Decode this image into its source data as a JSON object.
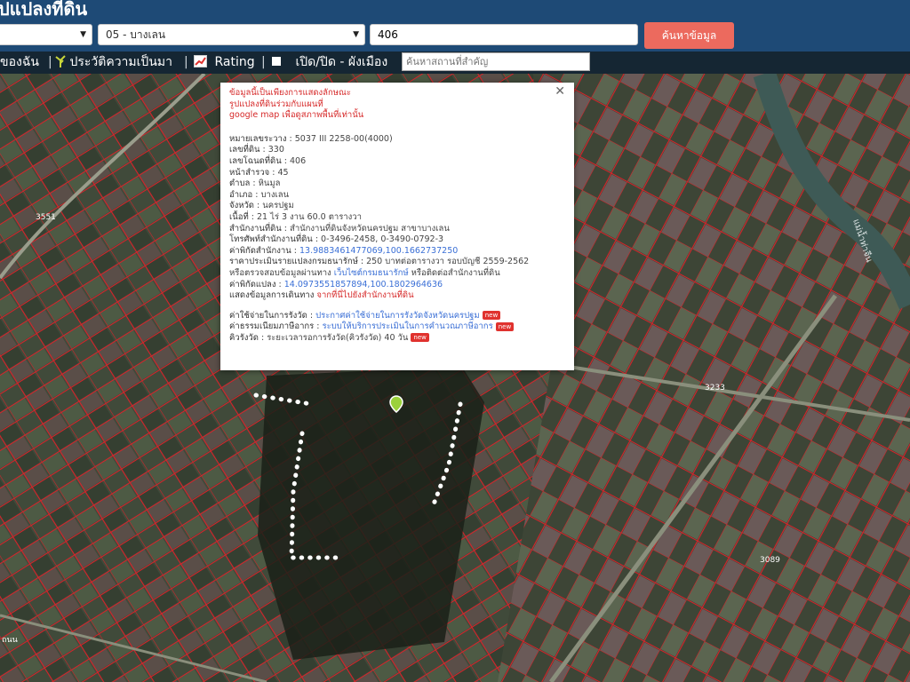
{
  "header": {
    "title": "ปแปลงที่ดิน",
    "province_select": "",
    "district_select": "05 - บางเลน",
    "parcel_value": "406",
    "search_label": "ค้นหาข้อมูล"
  },
  "toolbar": {
    "item1": "ของฉัน",
    "sep": "|",
    "item2": "ประวัติความเป็นมา",
    "item3": "Rating",
    "item4": "เปิด/ปิด - ผังเมือง",
    "place_placeholder": "ค้นหาสถานที่สำคัญ"
  },
  "map": {
    "road_labels": [
      "3551",
      "3233",
      "3089"
    ],
    "river_label": "แม่น้ำท่าจีน",
    "corner_label": "ถนน"
  },
  "popup": {
    "notice": [
      "ข้อมูลนี้เป็นเพียงการแสดงลักษณะ",
      "รูปแปลงที่ดินร่วมกับแผนที่",
      "google map เพื่อดูสภาพพื้นที่เท่านั้น"
    ],
    "fields": [
      {
        "label": "หมายเลขระวาง",
        "value": "5037 III 2258-00(4000)"
      },
      {
        "label": "เลขที่ดิน",
        "value": "330"
      },
      {
        "label": "เลขโฉนดที่ดิน",
        "value": "406"
      },
      {
        "label": "หน้าสำรวจ",
        "value": "45"
      },
      {
        "label": "ตำบล",
        "value": "หินมูล"
      },
      {
        "label": "อำเภอ",
        "value": "บางเลน"
      },
      {
        "label": "จังหวัด",
        "value": "นครปฐม"
      },
      {
        "label": "เนื้อที่",
        "value": "21 ไร่ 3 งาน 60.0 ตารางวา"
      },
      {
        "label": "สำนักงานที่ดิน",
        "value": "สำนักงานที่ดินจังหวัดนครปฐม สาขาบางเลน"
      },
      {
        "label": "โทรศัพท์สำนักงานที่ดิน",
        "value": "0-3496-2458, 0-3490-0792-3"
      }
    ],
    "office_coord_label": "ค่าพิกัดสำนักงาน",
    "office_coord_value": "13.9883461477069,100.1662737250",
    "price_label": "ราคาประเมินรายแปลงกรมธนารักษ์",
    "price_value": "250 บาทต่อตารางวา รอบบัญชี 2559-2562",
    "check_prefix": "หรือตรวจสอบข้อมูลผ่านทาง",
    "check_link": "เว็บไซต์กรมธนารักษ์",
    "check_suffix": "หรือติดต่อสำนักงานที่ดิน",
    "parcel_coord_label": "ค่าพิกัดแปลง",
    "parcel_coord_value": "14.0973551857894,100.1802964636",
    "route_label": "แสดงข้อมูลการเดินทาง",
    "route_link": "จากที่นี่ไปยังสำนักงานที่ดิน",
    "fee_label": "ค่าใช้จ่ายในการรังวัด",
    "fee_link": "ประกาศค่าใช้จ่ายในการรังวัดจังหวัดนครปฐม",
    "reg_label": "ค่าธรรมเนียมภาษีอากร",
    "reg_link": "ระบบให้บริการประเมินในการคำนวณภาษีอากร",
    "queue_label": "คิวรังวัด",
    "queue_value": "ระยะเวลารอการรังวัด(คิวรังวัด) 40 วัน",
    "new_badge": "new"
  }
}
